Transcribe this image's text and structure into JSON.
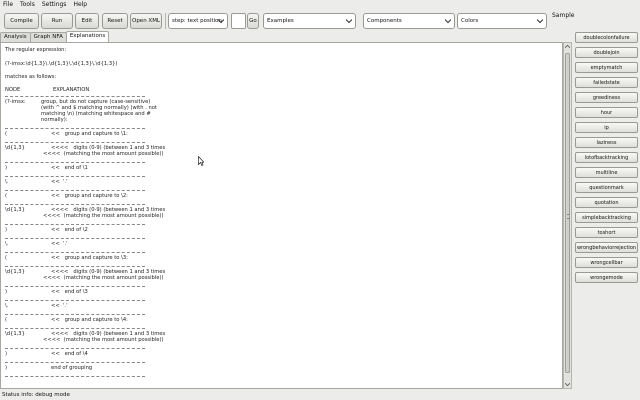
{
  "menu": [
    "File",
    "Tools",
    "Settings",
    "Help"
  ],
  "toolbar": {
    "compile": "Compile",
    "run": "Run",
    "edit": "Edit",
    "reset": "Reset",
    "open_xml": "Open XML",
    "step_combo": "step: text position",
    "go": "Go",
    "examples_combo": "Examples",
    "components_combo": "Components",
    "colors_combo": "Colors",
    "sample_label": "Sample"
  },
  "tabs": [
    "Analysis",
    "Graph NFA",
    "Explanations"
  ],
  "panel": {
    "line1": "The regular expression:",
    "line2": "(?-imsx:\\d{1,3}\\.\\d{1,3}\\.\\d{1,3}\\.\\d{1,3})",
    "line3": "matches as follows:",
    "hdr_node": "NODE",
    "hdr_expl": "EXPLANATION",
    "blocks": [
      {
        "node": "(?-imsx:",
        "lines": [
          "group, but do not capture (case-sensitive)",
          "(with ^ and $ matching normally) (with . not",
          "matching \\n) (matching whitespace and #",
          "normally):"
        ]
      },
      {
        "node": "(",
        "lines": [
          "<<   group and capture to \\1:"
        ]
      },
      {
        "node": "\\d{1,3}",
        "lines": [
          "<<<<   digits (0-9) (between 1 and 3 times",
          "<<<<  (matching the most amount possible))"
        ]
      },
      {
        "node": ")",
        "lines": [
          "<<   end of \\1"
        ]
      },
      {
        "node": "\\.",
        "lines": [
          "<<  '.'"
        ]
      },
      {
        "node": "(",
        "lines": [
          "<<   group and capture to \\2:"
        ]
      },
      {
        "node": "\\d{1,3}",
        "lines": [
          "<<<<   digits (0-9) (between 1 and 3 times",
          "<<<<  (matching the most amount possible))"
        ]
      },
      {
        "node": ")",
        "lines": [
          "<<   end of \\2"
        ]
      },
      {
        "node": "\\.",
        "lines": [
          "<<  '.'"
        ]
      },
      {
        "node": "(",
        "lines": [
          "<<   group and capture to \\3:"
        ]
      },
      {
        "node": "\\d{1,3}",
        "lines": [
          "<<<<   digits (0-9) (between 1 and 3 times",
          "<<<<  (matching the most amount possible))"
        ]
      },
      {
        "node": ")",
        "lines": [
          "<<   end of \\3"
        ]
      },
      {
        "node": "\\.",
        "lines": [
          "<<  '.'"
        ]
      },
      {
        "node": "(",
        "lines": [
          "<<   group and capture to \\4:"
        ]
      },
      {
        "node": "\\d{1,3}",
        "lines": [
          "<<<<   digits (0-9) (between 1 and 3 times",
          "<<<<  (matching the most amount possible))"
        ]
      },
      {
        "node": ")",
        "lines": [
          "<<   end of \\4"
        ]
      },
      {
        "node": ")",
        "lines": [
          "end of grouping"
        ]
      }
    ]
  },
  "samples": [
    "doublecolonfailure",
    "doublejoin",
    "emptymatch",
    "failedstate",
    "greediness",
    "hour",
    "ip",
    "laziness",
    "lotofbacktracking",
    "multiline",
    "questionmark",
    "quotation",
    "simplebacktracking",
    "toshort",
    "wrongbehaviorrejection",
    "wrongcellbar",
    "wrongemode"
  ],
  "status": "Status info: debug mode"
}
